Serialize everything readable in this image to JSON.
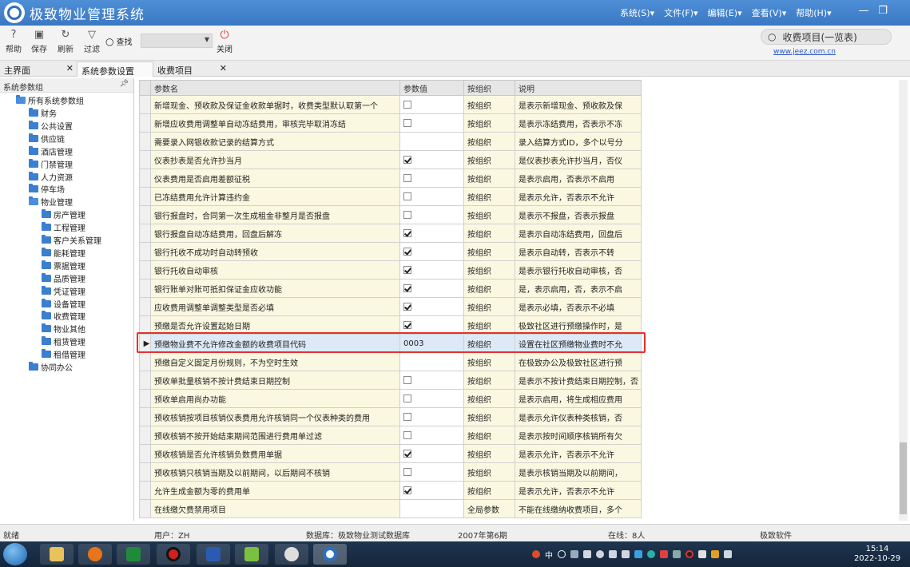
{
  "app": {
    "title": "极致物业管理系统"
  },
  "menu": [
    {
      "label": "系统(S)▾"
    },
    {
      "label": "文件(F)▾"
    },
    {
      "label": "编辑(E)▾"
    },
    {
      "label": "查看(V)▾"
    },
    {
      "label": "帮助(H)▾"
    }
  ],
  "toolbar": {
    "help": "帮助",
    "save": "保存",
    "refresh": "刷新",
    "filter": "过滤",
    "search_label": "查找",
    "close": "关闭"
  },
  "global_search": {
    "value": "收费项目(一览表)"
  },
  "site_link": "www.jeez.com.cn",
  "tabs": [
    {
      "label": "主界面",
      "active": false
    },
    {
      "label": "系统参数设置",
      "active": true
    },
    {
      "label": "收费项目",
      "active": false
    }
  ],
  "sidebar": {
    "header": "系统参数组",
    "root": "所有系统参数组",
    "items": [
      {
        "label": "财务"
      },
      {
        "label": "公共设置"
      },
      {
        "label": "供应链"
      },
      {
        "label": "酒店管理"
      },
      {
        "label": "门禁管理"
      },
      {
        "label": "人力资源"
      },
      {
        "label": "停车场"
      },
      {
        "label": "物业管理"
      },
      {
        "label": "房产管理"
      },
      {
        "label": "工程管理"
      },
      {
        "label": "客户关系管理"
      },
      {
        "label": "能耗管理"
      },
      {
        "label": "票据管理"
      },
      {
        "label": "品质管理"
      },
      {
        "label": "凭证管理"
      },
      {
        "label": "设备管理"
      },
      {
        "label": "收费管理"
      },
      {
        "label": "物业其他"
      },
      {
        "label": "租赁管理"
      },
      {
        "label": "租借管理"
      },
      {
        "label": "协同办公"
      }
    ]
  },
  "grid": {
    "columns": [
      "参数名",
      "参数值",
      "按组织",
      "说明"
    ],
    "rows": [
      {
        "name": "新增现金、预收款及保证金收款单据时，收费类型默认取第一个",
        "value_type": "checkbox",
        "checked": false,
        "value": "",
        "group": "按组织",
        "desc": "是表示新增现金、预收款及保"
      },
      {
        "name": "新增应收费用调整单自动冻结费用，审核完毕取消冻结",
        "value_type": "checkbox",
        "checked": false,
        "value": "",
        "group": "按组织",
        "desc": "是表示冻结费用，否表示不冻"
      },
      {
        "name": "需要录入网银收款记录的结算方式",
        "value_type": "text",
        "checked": false,
        "value": "",
        "group": "按组织",
        "desc": "录入结算方式ID，多个以号分"
      },
      {
        "name": "仪表抄表是否允许抄当月",
        "value_type": "checkbox",
        "checked": true,
        "value": "",
        "group": "按组织",
        "desc": "是仪表抄表允许抄当月，否仪"
      },
      {
        "name": "仪表费用是否启用差额征税",
        "value_type": "checkbox",
        "checked": false,
        "value": "",
        "group": "按组织",
        "desc": "是表示启用，否表示不启用"
      },
      {
        "name": "已冻结费用允许计算违约金",
        "value_type": "checkbox",
        "checked": false,
        "value": "",
        "group": "按组织",
        "desc": "是表示允许，否表示不允许"
      },
      {
        "name": "银行报盘时，合同第一次生成租金非整月是否报盘",
        "value_type": "checkbox",
        "checked": false,
        "value": "",
        "group": "按组织",
        "desc": "是表示不报盘，否表示报盘"
      },
      {
        "name": "银行报盘自动冻结费用，回盘后解冻",
        "value_type": "checkbox",
        "checked": true,
        "value": "",
        "group": "按组织",
        "desc": "是表示自动冻结费用，回盘后"
      },
      {
        "name": "银行托收不成功时自动转预收",
        "value_type": "checkbox",
        "checked": true,
        "value": "",
        "group": "按组织",
        "desc": "是表示自动转，否表示不转"
      },
      {
        "name": "银行托收自动审核",
        "value_type": "checkbox",
        "checked": true,
        "value": "",
        "group": "按组织",
        "desc": "是表示银行托收自动审核，否"
      },
      {
        "name": "银行账单对账可抵扣保证金应收功能",
        "value_type": "checkbox",
        "checked": true,
        "value": "",
        "group": "按组织",
        "desc": "是，表示启用，否，表示不启"
      },
      {
        "name": "应收费用调整单调整类型是否必填",
        "value_type": "checkbox",
        "checked": true,
        "value": "",
        "group": "按组织",
        "desc": "是表示必填，否表示不必填"
      },
      {
        "name": "预缴是否允许设置起始日期",
        "value_type": "checkbox",
        "checked": true,
        "value": "",
        "group": "按组织",
        "desc": "极致社区进行预缴操作时，是"
      },
      {
        "name": "预缴物业费不允许修改金额的收费项目代码",
        "value_type": "text",
        "checked": false,
        "value": "0003",
        "group": "按组织",
        "desc": "设置在社区预缴物业费时不允",
        "selected": true
      },
      {
        "name": "预缴自定义固定月份规则，不为空时生效",
        "value_type": "text",
        "checked": false,
        "value": "",
        "group": "按组织",
        "desc": "在极致办公及极致社区进行预"
      },
      {
        "name": "预收单批量核销不按计费结束日期控制",
        "value_type": "checkbox",
        "checked": false,
        "value": "",
        "group": "按组织",
        "desc": "是表示不按计费结束日期控制，否"
      },
      {
        "name": "预收单启用尚办功能",
        "value_type": "checkbox",
        "checked": false,
        "value": "",
        "group": "按组织",
        "desc": "是表示启用，将生成相应费用"
      },
      {
        "name": "预收核销按项目核销仪表费用允许核销同一个仪表种类的费用",
        "value_type": "checkbox",
        "checked": false,
        "value": "",
        "group": "按组织",
        "desc": "是表示允许仪表种类核销，否"
      },
      {
        "name": "预收核销不按开始结束期间范围进行费用单过滤",
        "value_type": "checkbox",
        "checked": false,
        "value": "",
        "group": "按组织",
        "desc": "是表示按时间顺序核销所有欠"
      },
      {
        "name": "预收核销是否允许核销负数费用单据",
        "value_type": "checkbox",
        "checked": true,
        "value": "",
        "group": "按组织",
        "desc": "是表示允许，否表示不允许"
      },
      {
        "name": "预收核销只核销当期及以前期间，以后期间不核销",
        "value_type": "checkbox",
        "checked": false,
        "value": "",
        "group": "按组织",
        "desc": "是表示核销当期及以前期间，"
      },
      {
        "name": "允许生成金额为零的费用单",
        "value_type": "checkbox",
        "checked": true,
        "value": "",
        "group": "按组织",
        "desc": "是表示允许，否表示不允许"
      },
      {
        "name": "在线缴欠费禁用项目",
        "value_type": "text",
        "checked": false,
        "value": "",
        "group": "全局参数",
        "desc": "不能在线缴纳收费项目，多个"
      }
    ]
  },
  "status": {
    "state": "就绪",
    "user": "用户：ZH",
    "database": "数据库：极致物业测试数据库",
    "period": "2007年第6期",
    "online": "在线：8人",
    "vendor": "极致软件"
  },
  "taskbar": {
    "time": "15:14",
    "date": "2022-10-29",
    "ime": "中"
  }
}
